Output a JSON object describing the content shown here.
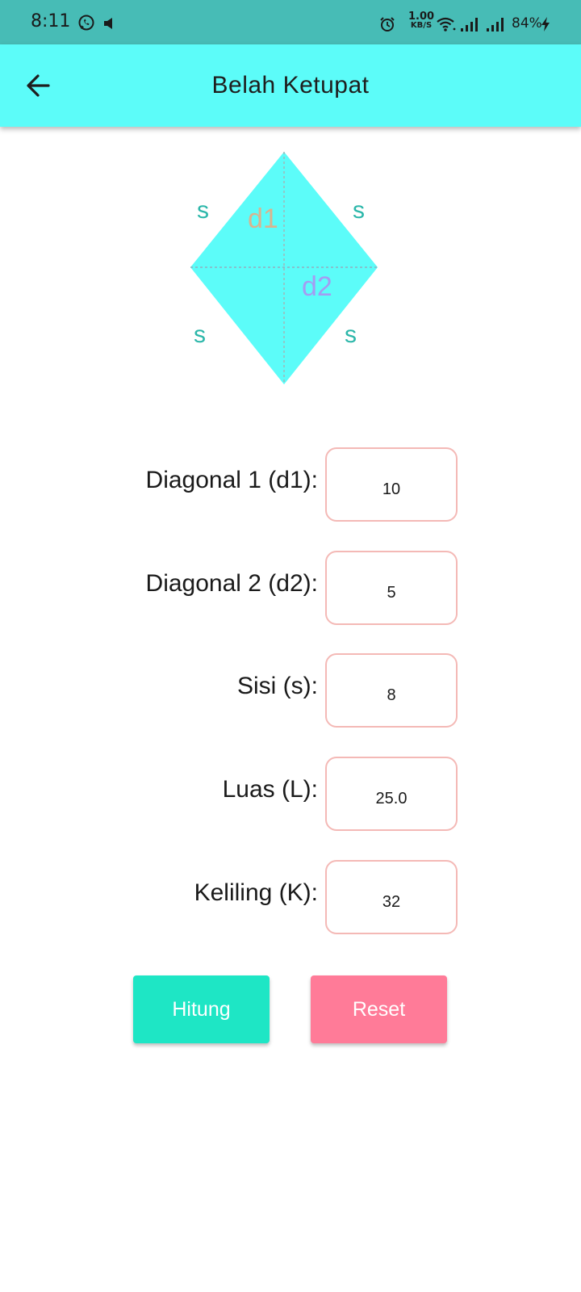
{
  "status_bar": {
    "time": "8:11",
    "net_speed_value": "1.00",
    "net_speed_unit": "KB/S",
    "battery": "84%",
    "bg_color": "#47bcb6"
  },
  "app_bar": {
    "title": "Belah Ketupat",
    "bg_color": "#5cfcf9"
  },
  "diagram": {
    "side_labels": [
      "s",
      "s",
      "s",
      "s"
    ],
    "diagonal_1_label": "d1",
    "diagonal_2_label": "d2",
    "fill_color": "#5cfcf9",
    "side_label_color": "#2cb7aa",
    "d1_label_color": "#d9b48f",
    "d2_label_color": "#a49cf2"
  },
  "form": {
    "fields": [
      {
        "label": "Diagonal 1 (d1):",
        "value": "10"
      },
      {
        "label": "Diagonal 2 (d2):",
        "value": "5"
      },
      {
        "label": "Sisi (s):",
        "value": "8"
      },
      {
        "label": "Luas (L):",
        "value": "25.0"
      },
      {
        "label": "Keliling (K):",
        "value": "32"
      }
    ],
    "input_border_color": "#f4b9b6"
  },
  "buttons": {
    "calculate_label": "Hitung",
    "reset_label": "Reset",
    "calculate_color": "#1ee6c5",
    "reset_color": "#ff7b98"
  }
}
